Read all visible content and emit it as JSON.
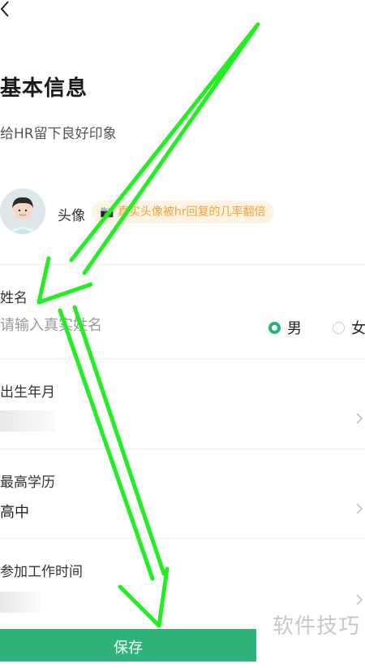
{
  "header": {
    "back_icon": "chevron-left-icon"
  },
  "page": {
    "title": "基本信息",
    "subtitle": "给HR留下良好印象"
  },
  "avatar": {
    "label": "头像",
    "tip": "📷 真实头像被hr回复的几率翻倍",
    "tip_color": "#f0a23c"
  },
  "form": {
    "name": {
      "label": "姓名",
      "placeholder": "请输入真实姓名"
    },
    "gender": {
      "options": [
        "男",
        "女"
      ],
      "selected": "男"
    },
    "birth": {
      "label": "出生年月"
    },
    "education": {
      "label": "最高学历",
      "value": "高中"
    },
    "work_start": {
      "label": "参加工作时间"
    }
  },
  "actions": {
    "save_label": "保存"
  },
  "watermark": "软件技巧",
  "colors": {
    "accent": "#2fb37a",
    "annotation_arrow": "#22ee22"
  }
}
